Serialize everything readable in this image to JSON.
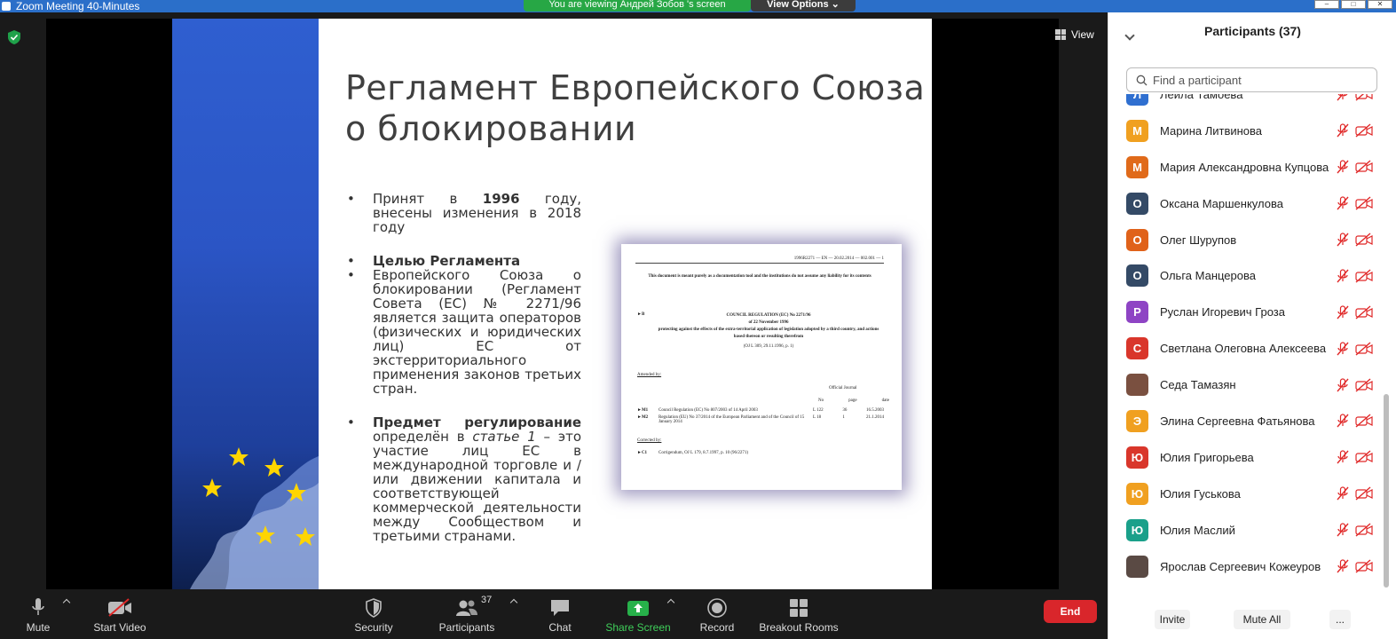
{
  "window": {
    "title": "Zoom Meeting 40-Minutes",
    "viewing_banner": "You are viewing Андрей Зобов 's screen",
    "view_options": "View Options ⌄"
  },
  "top_right": {
    "view_label": "View"
  },
  "slide": {
    "title_line1": "Регламент Европейского Союза",
    "title_line2": "о блокировании",
    "bullet1_a": "Принят в ",
    "bullet1_b": "1996",
    "bullet1_c": " году, внесены изменения в 2018 году",
    "bullet2_head": "Целью Регламента",
    "bullet3": "Европейского Союза о блокировании (Регламент Совета (ЕС) № 2271/96 является защита операторов (физических и юридических лиц) ЕС от экстерриториального применения законов третьих стран.",
    "bullet4_head": "Предмет регулирование",
    "bullet4_a": " определён в ",
    "bullet4_b": "статье 1",
    "bullet4_c": " – это участие лиц ЕС в международной торговле и / или движении капитала и соответствующей коммерческой деятельности между Сообществом и третьими странами."
  },
  "doc": {
    "header": "1996R2271 — EN — 20.02.2014 — 002.001 — 1",
    "disclaimer": "This document is meant purely as a documentation tool and the institutions do not assume any liability for its contents",
    "marker": "►B",
    "reg_line1": "COUNCIL REGULATION (EC) No 2271/96",
    "reg_line2": "of 22 November 1996",
    "reg_line3": "protecting against the effects of the extra-territorial application of legislation adopted by a third country, and actions based thereon or resulting therefrom",
    "oj_ref": "(OJ L 309, 29.11.1996, p. 1)",
    "amended_by": "Amended by:",
    "official_journal": "Official Journal",
    "col_no": "No",
    "col_page": "page",
    "col_date": "date",
    "rows": [
      {
        "key": "►M1",
        "text": "Council Regulation (EC) No 807/2003 of 14 April 2003",
        "no": "L 122",
        "page": "36",
        "date": "16.5.2003"
      },
      {
        "key": "►M2",
        "text": "Regulation (EU) No 37/2014 of the European Parliament and of the Council of 15 January 2014",
        "no": "L 18",
        "page": "1",
        "date": "21.1.2014"
      }
    ],
    "corrected_by": "Corrected by:",
    "c1_key": "►C1",
    "c1_text": "Corrigendum, OJ L 179, 8.7.1997, p. 10 (96/2271)"
  },
  "participants": {
    "title": "Participants (37)",
    "search_placeholder": "Find a participant",
    "list": [
      {
        "initial": "Л",
        "name": "Лейла Тамоева",
        "color": "#2f6fd0"
      },
      {
        "initial": "М",
        "name": "Марина Литвинова",
        "color": "#f0a020"
      },
      {
        "initial": "М",
        "name": "Мария Александровна Купцова",
        "color": "#e06a1a"
      },
      {
        "initial": "О",
        "name": "Оксана Маршенкулова",
        "color": "#344a66"
      },
      {
        "initial": "О",
        "name": "Олег Шурупов",
        "color": "#e0621a"
      },
      {
        "initial": "О",
        "name": "Ольга Манцерова",
        "color": "#344a66"
      },
      {
        "initial": "Р",
        "name": "Руслан Игоревич Гроза",
        "color": "#8e44c4"
      },
      {
        "initial": "С",
        "name": "Светлана Олеговна Алексеева",
        "color": "#d9362b"
      },
      {
        "initial": "",
        "name": "Седа Тамазян",
        "color": "#7a5040"
      },
      {
        "initial": "Э",
        "name": "Элина Сергеевна Фатьянова",
        "color": "#f0a020"
      },
      {
        "initial": "Ю",
        "name": "Юлия Григорьева",
        "color": "#d9362b"
      },
      {
        "initial": "Ю",
        "name": "Юлия Гуськова",
        "color": "#f0a020"
      },
      {
        "initial": "Ю",
        "name": "Юлия Маслий",
        "color": "#1aa08a"
      },
      {
        "initial": "",
        "name": "Ярослав Сергеевич Кожеуров",
        "color": "#5a4a44"
      }
    ],
    "invite": "Invite",
    "mute_all": "Mute All",
    "more": "..."
  },
  "toolbar": {
    "mute": "Mute",
    "start_video": "Start Video",
    "security": "Security",
    "participants": "Participants",
    "participants_count": "37",
    "chat": "Chat",
    "share_screen": "Share Screen",
    "record": "Record",
    "breakout_rooms": "Breakout Rooms",
    "end": "End"
  }
}
